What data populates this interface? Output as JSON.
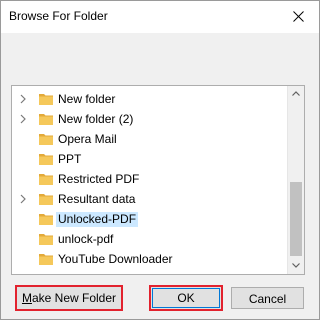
{
  "dialog": {
    "title": "Browse For Folder",
    "close_icon": "close-icon"
  },
  "tree": {
    "items": [
      {
        "label": "New folder",
        "expandable": true,
        "selected": false
      },
      {
        "label": "New folder (2)",
        "expandable": true,
        "selected": false
      },
      {
        "label": "Opera Mail",
        "expandable": false,
        "selected": false
      },
      {
        "label": "PPT",
        "expandable": false,
        "selected": false
      },
      {
        "label": "Restricted PDF",
        "expandable": false,
        "selected": false
      },
      {
        "label": "Resultant data",
        "expandable": true,
        "selected": false
      },
      {
        "label": "Unlocked-PDF",
        "expandable": false,
        "selected": true
      },
      {
        "label": "unlock-pdf",
        "expandable": false,
        "selected": false
      },
      {
        "label": "YouTube Downloader",
        "expandable": false,
        "selected": false
      }
    ]
  },
  "buttons": {
    "make_new_folder_prefix": "M",
    "make_new_folder_rest": "ake New Folder",
    "ok": "OK",
    "cancel": "Cancel"
  },
  "colors": {
    "highlight": "#e2222e",
    "selection": "#cce8ff",
    "folder": "#f5c85a",
    "focus": "#0078d7"
  }
}
